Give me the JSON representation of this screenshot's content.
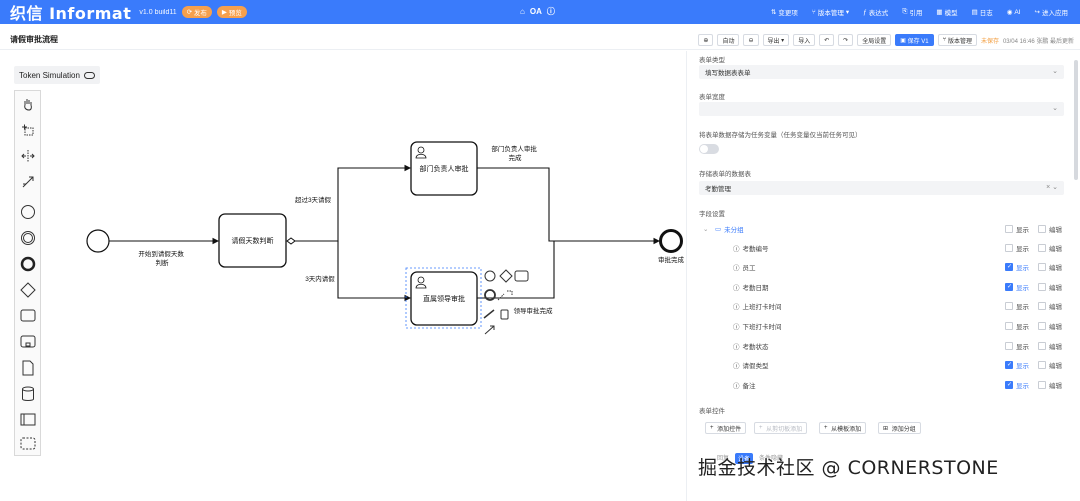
{
  "topbar": {
    "brand": "织信 Informat",
    "build": "v1.0 build11",
    "publish": "发布",
    "preview": "预览",
    "app_name": "OA",
    "menu": [
      "变更项",
      "版本管理",
      "表达式",
      "引用",
      "模型",
      "日志",
      "AI",
      "进入应用"
    ],
    "color_brand": "#3a7bfb"
  },
  "subbar": {
    "title": "请假审批流程",
    "auto": "自动",
    "export": "导出",
    "import": "导入",
    "global_settings": "全局设置",
    "save": "保存 V1",
    "version_mgmt": "版本管理",
    "unsaved": "未保存",
    "saved_time": "03/04 16:46 张鹏 最后更新"
  },
  "token_simulation": "Token Simulation",
  "diagram": {
    "start_label": "开始到请假天数\n判断",
    "gateway_task": "请假天数判断",
    "dept_task": "部门负责人审批",
    "leader_task": "直属领导审批",
    "end_label": "审批完成",
    "flow_over3": "超过3天请假",
    "flow_within3": "3天内请假",
    "flow_dept_done": "部门负责人审批\n完成",
    "flow_leader_done": "领导审批完成"
  },
  "panel": {
    "form_type_label": "表单类型",
    "form_type_value": "填写数据表表单",
    "form_width_label": "表单宽度",
    "store_var_label": "将表单数据存储为任务变量（任务变量仅当前任务可见）",
    "store_table_label": "存储表单的数据表",
    "store_table_value": "考勤管理",
    "field_settings_label": "字段设置",
    "show": "显示",
    "edit": "编辑",
    "group": "未分组",
    "fields": [
      {
        "name": "考勤编号",
        "show": false
      },
      {
        "name": "员工",
        "show": true
      },
      {
        "name": "考勤日期",
        "show": true
      },
      {
        "name": "上班打卡时间",
        "show": false
      },
      {
        "name": "下班打卡时间",
        "show": false
      },
      {
        "name": "考勤状态",
        "show": false
      },
      {
        "name": "请假类型",
        "show": true
      },
      {
        "name": "备注",
        "show": true
      }
    ],
    "controls_label": "表单控件",
    "add_control": "添加控件",
    "from_clipboard": "从剪切板添加",
    "from_template": "从模板添加",
    "add_group": "添加分组",
    "bottom_tabs": [
      "回复",
      "设备",
      "条件隐藏"
    ]
  },
  "watermark": "掘金技术社区 @ CORNERSTONE"
}
